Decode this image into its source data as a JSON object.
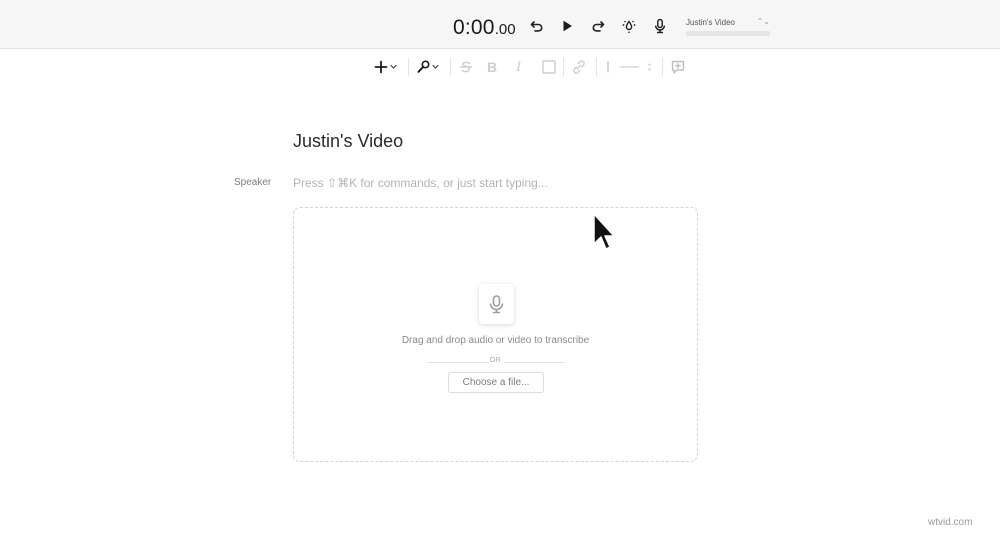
{
  "transport": {
    "timecode_main": "0:00",
    "timecode_frac": ".00",
    "composition_name": "Justin's Video"
  },
  "icons": {
    "undo": "undo-icon",
    "play": "play-icon",
    "redo": "redo-icon",
    "drip": "drip-icon",
    "microphone": "microphone-icon",
    "add": "plus-icon",
    "tools": "wrench-icon",
    "strikethrough": "strikethrough-icon",
    "bold": "bold-icon",
    "italic": "italic-icon",
    "box": "square-icon",
    "link": "link-icon",
    "marker": "marker-icon",
    "comment": "comment-plus-icon"
  },
  "toolbar": {
    "bold_glyph": "B",
    "italic_glyph": "I"
  },
  "document": {
    "title": "Justin's Video",
    "speaker_label": "Speaker",
    "command_hint": "Press ⇧⌘K for commands, or just start typing..."
  },
  "dropzone": {
    "instructions": "Drag and drop audio or video to transcribe",
    "or_label": "OR",
    "choose_file_label": "Choose a file..."
  },
  "watermark": {
    "text": "wtvid.com"
  },
  "colors": {
    "topbar_bg": "#f6f6f6",
    "icon_dark": "#222222",
    "icon_disabled": "#cfcfcf",
    "dashed_border": "#d4d4d4"
  }
}
